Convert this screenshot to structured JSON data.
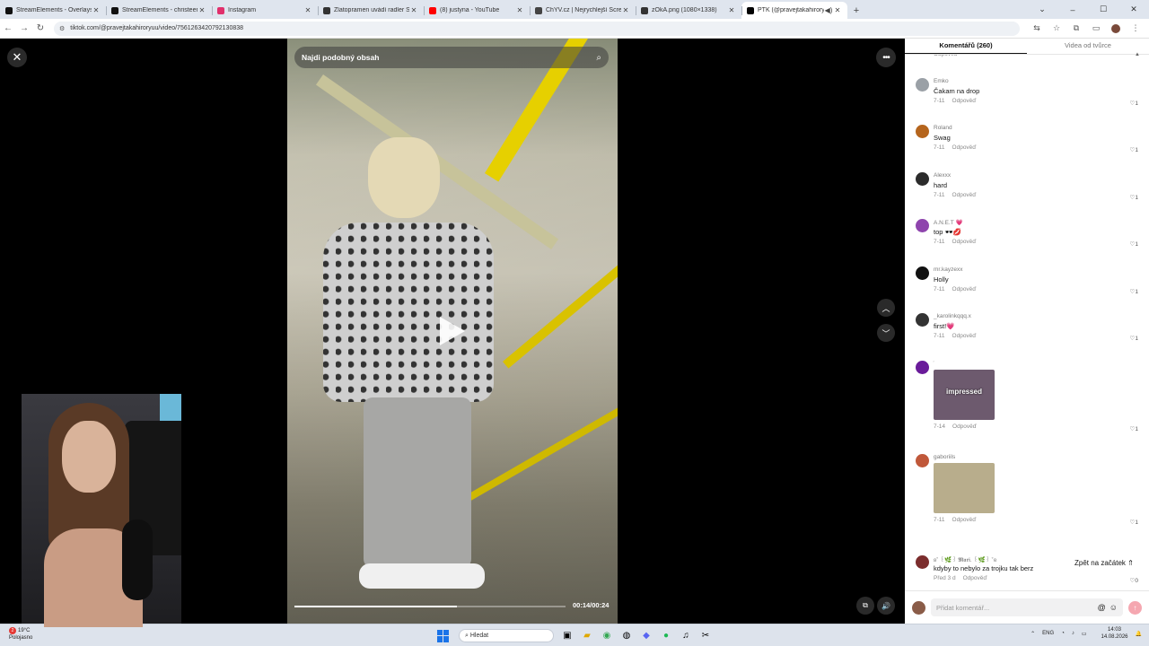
{
  "browser": {
    "tabs": [
      {
        "title": "StreamElements - Overlays",
        "fav": "#111111",
        "active": false
      },
      {
        "title": "StreamElements - christeenes",
        "fav": "#111111",
        "active": false
      },
      {
        "title": "Instagram",
        "fav": "#e1306c",
        "active": false
      },
      {
        "title": "Zlatopramen uvádí radler Soul",
        "fav": "#333333",
        "active": false
      },
      {
        "title": "(8) justyna - YouTube",
        "fav": "#ff0000",
        "active": false
      },
      {
        "title": "ChYV.cz | Nejrychlejší Screenšot",
        "fav": "#444444",
        "active": false
      },
      {
        "title": "zOkA.png (1080×1338)",
        "fav": "#333333",
        "active": false
      },
      {
        "title": "PTK (@pravejtakahiroryuu)",
        "fav": "#010101",
        "active": true
      }
    ],
    "url": "tiktok.com/@pravejtakahiroryuu/video/7561263420792130838"
  },
  "video": {
    "search_placeholder": "Najdi podobný obsah",
    "time": "00:14/00:24",
    "progress": 0.6
  },
  "panel": {
    "tab_comments": "Komentářů (260)",
    "tab_creator": "Videa od tvůrce",
    "reply_label": "Odpověď",
    "back_to_top": "Zpět na začátek",
    "input_placeholder": "Přidat komentář...",
    "comments": [
      {
        "user": "Emko",
        "text": "Čakam na drop",
        "date": "7-11",
        "likes": "1",
        "avatar": "#9aa0a6",
        "sticker": null
      },
      {
        "user": "Roland",
        "text": "Swag",
        "date": "7-11",
        "likes": "1",
        "avatar": "#b5651d",
        "sticker": null
      },
      {
        "user": "Alexxx",
        "text": "hard",
        "date": "7-11",
        "likes": "1",
        "avatar": "#2b2b2b",
        "sticker": null
      },
      {
        "user": "A.N.E.T 💗",
        "text": "top 🕶️💋",
        "date": "7-11",
        "likes": "1",
        "avatar": "#8e44ad",
        "sticker": null
      },
      {
        "user": "mr.kayzexx",
        "text": "Holly",
        "date": "7-11",
        "likes": "1",
        "avatar": "#111111",
        "sticker": null
      },
      {
        "user": "_karolinkqqq.x",
        "text": "first!💗",
        "date": "7-11",
        "likes": "1",
        "avatar": "#333333",
        "sticker": null
      },
      {
        "user": "͗",
        "text": "",
        "date": "7-14",
        "likes": "1",
        "avatar": "#6a1b9a",
        "sticker": {
          "label": "impressed",
          "color": "#6d5a6e"
        }
      },
      {
        "user": "gaboriils",
        "text": "",
        "date": "7-11",
        "likes": "1",
        "avatar": "#c0583a",
        "sticker": {
          "label": "",
          "color": "#b8ad8c"
        }
      },
      {
        "user": "ʚ˚ ꒰🌿꒱ 𝕸𝖆𝖗𝖎. ꒰🌿꒱ ˚ɞ",
        "text": "kdyby to nebylo za trojku tak berz",
        "date": "Před 3 d",
        "likes": "0",
        "avatar": "#7b2d2d",
        "sticker": null
      }
    ]
  },
  "taskbar": {
    "temp": "19°C",
    "weather": "Polojasno",
    "notif": "2",
    "search_label": "Hledat",
    "lang": "ENG",
    "time": "14:03",
    "date": "14.08.2026"
  }
}
